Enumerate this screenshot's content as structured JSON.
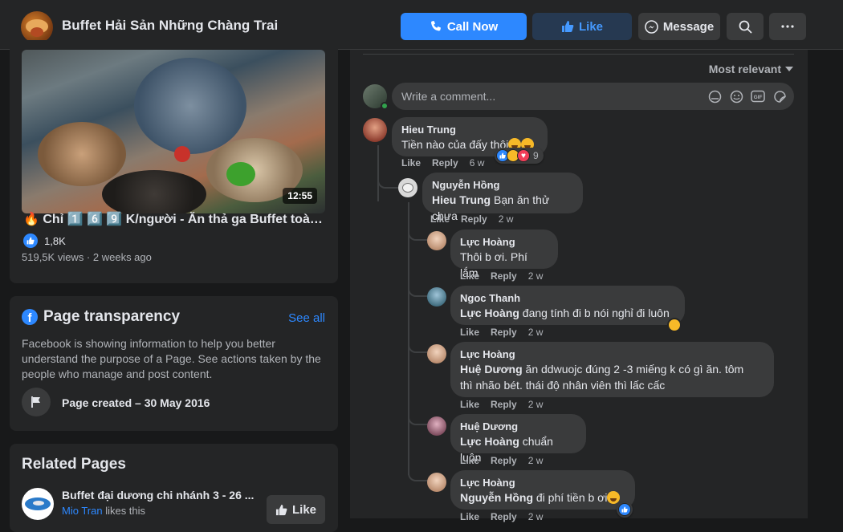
{
  "header": {
    "page_name": "Buffet Hải Sản Những Chàng Trai",
    "call_label": "Call Now",
    "like_label": "Like",
    "message_label": "Message"
  },
  "video": {
    "duration": "12:55",
    "title": "🔥 Chỉ 1️⃣ 6️⃣ 9️⃣ K/người - Ăn thả ga Buffet toàn ...",
    "reaction_count": "1,8K",
    "meta": "519,5K views · 2 weeks ago"
  },
  "transparency": {
    "title": "Page transparency",
    "see_all": "See all",
    "description": "Facebook is showing information to help you better understand the purpose of a Page. See actions taken by the people who manage and post content.",
    "created": "Page created – 30 May 2016"
  },
  "related": {
    "title": "Related Pages",
    "item_name": "Buffet đại dương chi nhánh 3 - 26 ...",
    "item_friend": "Mio Tran",
    "item_suffix": " likes this",
    "like_label": "Like"
  },
  "comments_panel": {
    "sort_label": "Most relevant",
    "placeholder": "Write a comment..."
  },
  "comments": [
    {
      "author": "Hieu Trung",
      "mention": "",
      "text": "Tiền nào của đấy thôi",
      "time": "6 w",
      "reaction_count": "9"
    },
    {
      "author": "Nguyễn Hồng",
      "mention": "Hieu Trung",
      "text": " Bạn ăn thử chưa",
      "time": "2 w"
    },
    {
      "author": "Lực Hoàng",
      "mention": "",
      "text": "Thôi b ơi. Phí lắm",
      "time": "2 w"
    },
    {
      "author": "Ngoc Thanh",
      "mention": "Lực Hoàng",
      "text": " đang tính đi b nói nghỉ đi luôn",
      "time": "2 w"
    },
    {
      "author": "Lực Hoàng",
      "mention": "Huệ Dương",
      "text": " ăn ddwuojc đúng 2 -3 miếng k có gì ăn. tôm",
      "text2": "thì nhão bét. thái độ nhân viên thì lấc cấc",
      "time": "2 w"
    },
    {
      "author": "Huệ Dương",
      "mention": "Lực Hoàng",
      "text": " chuẩn luôn",
      "time": "2 w"
    },
    {
      "author": "Lực Hoàng",
      "mention": "Nguyễn Hồng",
      "text": " đi phí tiền b ơi",
      "time": "2 w"
    }
  ],
  "action_like": "Like",
  "action_reply": "Reply",
  "colors": {
    "accent": "#2d88ff",
    "background": "#18191a",
    "surface": "#242526",
    "bubble": "#3a3b3c"
  }
}
